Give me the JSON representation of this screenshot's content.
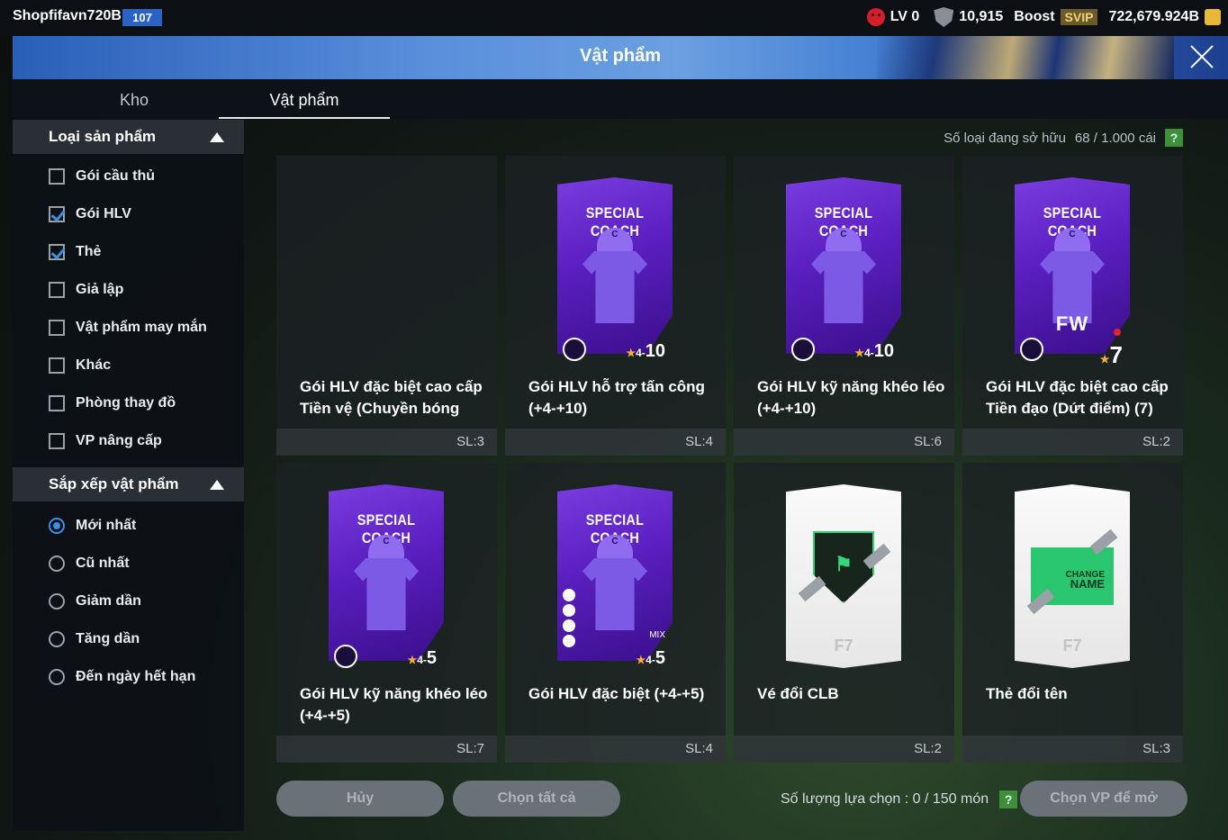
{
  "topbar": {
    "username": "Shopfifavn720B",
    "user_badge": "107",
    "level": "LV 0",
    "points": "10,915",
    "boost": "Boost",
    "svip": "SVIP",
    "balance": "722,679.924B"
  },
  "header": {
    "title": "Vật phẩm"
  },
  "tabs": [
    {
      "label": "Kho"
    },
    {
      "label": "Vật phẩm"
    }
  ],
  "sidebar": {
    "category_title": "Loại sản phẩm",
    "categories": [
      {
        "label": "Gói cầu thủ",
        "checked": false
      },
      {
        "label": "Gói HLV",
        "checked": true
      },
      {
        "label": "Thẻ",
        "checked": true
      },
      {
        "label": "Giả lập",
        "checked": false
      },
      {
        "label": "Vật phẩm may mắn",
        "checked": false
      },
      {
        "label": "Khác",
        "checked": false
      },
      {
        "label": "Phòng thay đồ",
        "checked": false
      },
      {
        "label": "VP nâng cấp",
        "checked": false
      }
    ],
    "sort_title": "Sắp xếp vật phẩm",
    "sorts": [
      {
        "label": "Mới nhất",
        "selected": true
      },
      {
        "label": "Cũ nhất",
        "selected": false
      },
      {
        "label": "Giảm dần",
        "selected": false
      },
      {
        "label": "Tăng dần",
        "selected": false
      },
      {
        "label": "Đến ngày hết hạn",
        "selected": false
      }
    ]
  },
  "owned": {
    "label": "Số loại đang sở hữu",
    "value": "68 / 1.000 cái",
    "help": "?"
  },
  "items": [
    {
      "name": "Gói HLV đặc biệt cao cấp Tiền vệ (Chuyền bóng",
      "qty": "SL:3",
      "art": "empty"
    },
    {
      "name": "Gói HLV hỗ trợ tấn công (+4-+10)",
      "qty": "SL:4",
      "art": "pack",
      "pack_title": "SPECIAL COACH",
      "cap_letter": "C",
      "icon": "lock-icon",
      "star": "★",
      "min": "4-",
      "max": "10"
    },
    {
      "name": "Gói HLV kỹ năng khéo léo (+4-+10)",
      "qty": "SL:6",
      "art": "pack",
      "pack_title": "SPECIAL COACH",
      "cap_letter": "C",
      "icon": "skill-icon",
      "star": "★",
      "min": "4-",
      "max": "10"
    },
    {
      "name": "Gói HLV đặc biệt cao cấp Tiền đạo (Dứt điểm) (7)",
      "qty": "SL:2",
      "art": "pack-fw",
      "pack_title": "SPECIAL COACH",
      "cap_letter": "C",
      "fw": "FW",
      "icon": "shoot-icon",
      "star": "★",
      "max": "7"
    },
    {
      "name": "Gói HLV kỹ năng khéo léo (+4-+5)",
      "qty": "SL:7",
      "art": "pack",
      "pack_title": "SPECIAL COACH",
      "cap_letter": "C",
      "icon": "skill-icon",
      "star": "★",
      "min": "4-",
      "max": "5"
    },
    {
      "name": "Gói HLV đặc biệt (+4-+5)",
      "qty": "SL:4",
      "art": "pack-mix",
      "pack_title": "SPECIAL COACH",
      "cap_letter": "C",
      "mix": "MIX",
      "star": "★",
      "min": "4-",
      "max": "5"
    },
    {
      "name": "Vé đổi CLB",
      "qty": "SL:2",
      "art": "club-ticket"
    },
    {
      "name": "Thẻ đổi tên",
      "qty": "SL:3",
      "art": "name-card",
      "card_text_1": "CHANGE",
      "card_text_2": "NAME"
    }
  ],
  "footer": {
    "cancel": "Hủy",
    "select_all": "Chọn tất cả",
    "selection_label": "Số lượng lựa chọn : 0 / 150 món",
    "help": "?",
    "open": "Chọn VP để mở"
  },
  "colors": {
    "accent": "#3c8fe3",
    "pack_purple": "#5a1fc0",
    "header_blue": "#4a82d2"
  }
}
